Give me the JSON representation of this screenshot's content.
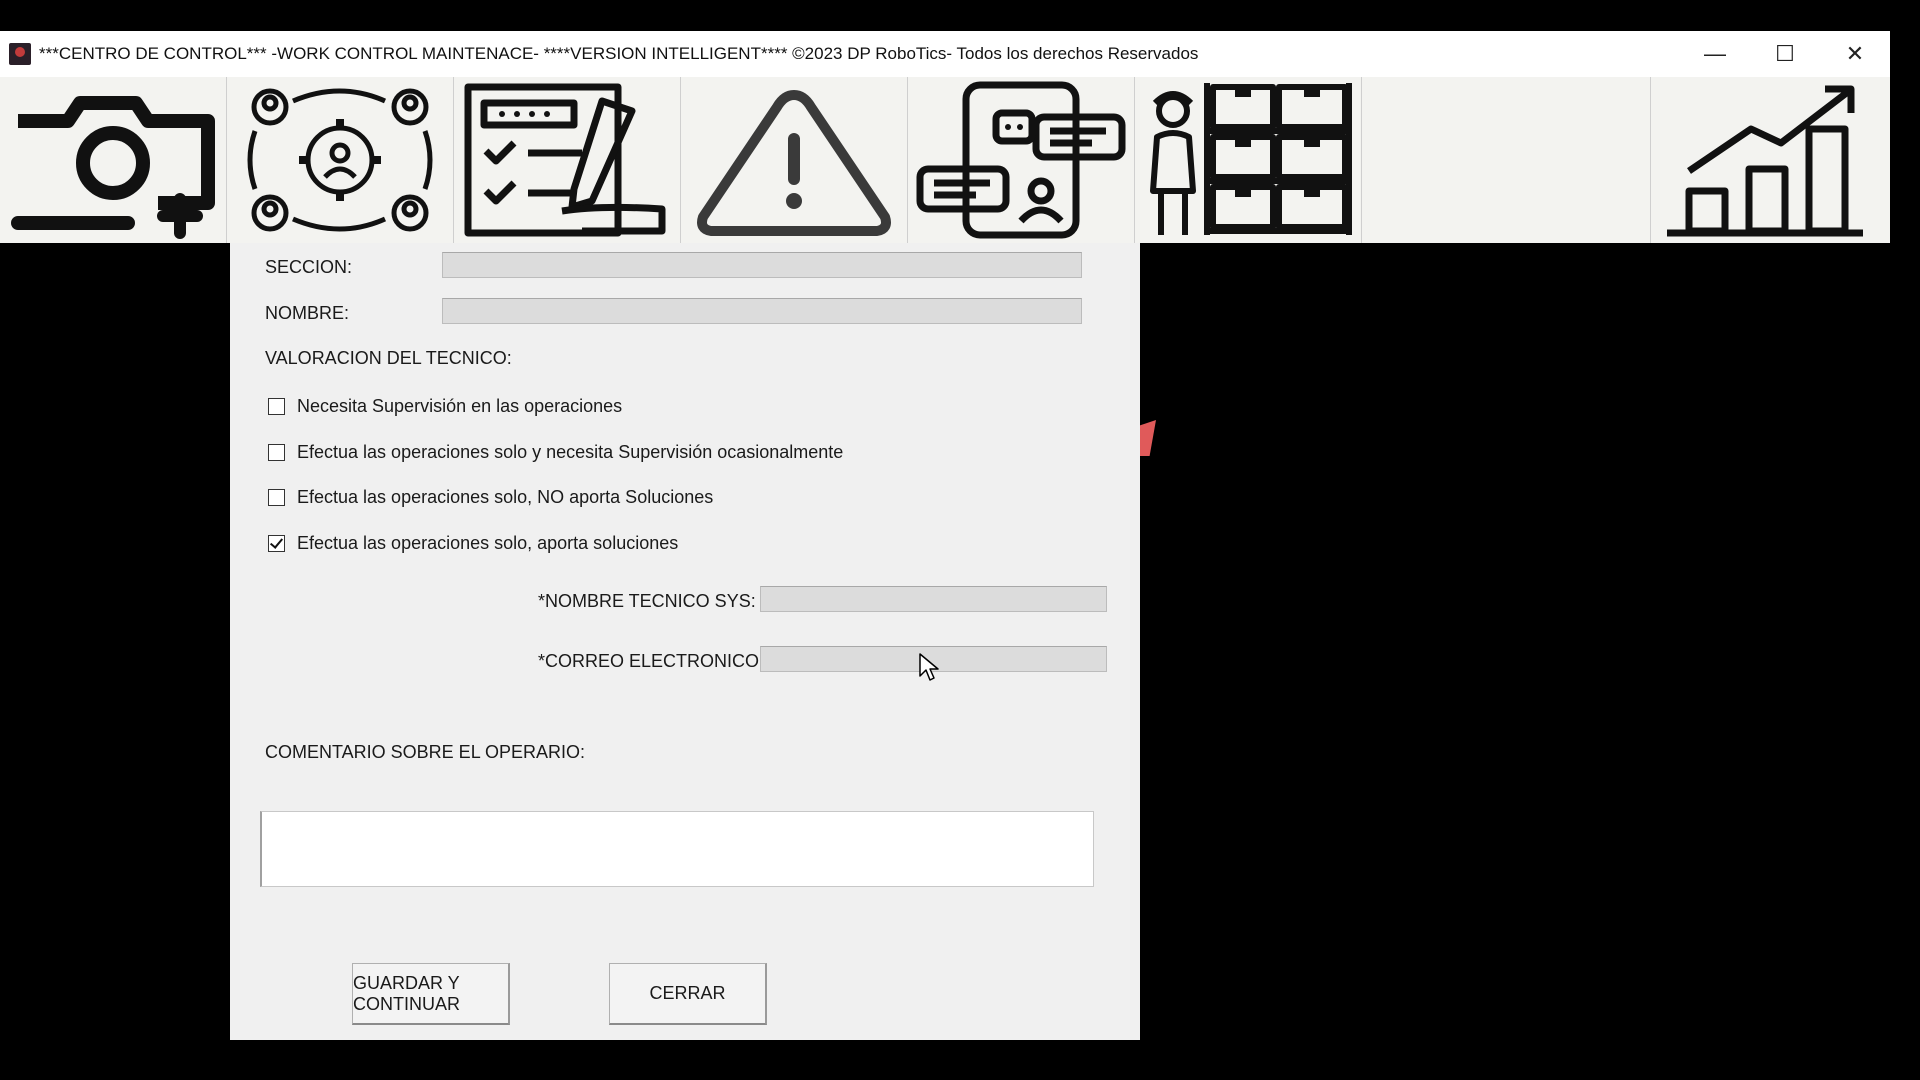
{
  "window": {
    "title": "***CENTRO DE CONTROL*** -WORK CONTROL MAINTENACE- ****VERSION INTELLIGENT****  ©2023 DP RoboTics- Todos los derechos Reservados",
    "controls": {
      "minimize": "—",
      "maximize": "☐",
      "close": "✕"
    }
  },
  "toolbar": {
    "buttons": [
      {
        "icon": "camera-plus-icon"
      },
      {
        "icon": "team-gear-cycle-icon"
      },
      {
        "icon": "checklist-sign-icon"
      },
      {
        "icon": "warning-triangle-icon"
      },
      {
        "icon": "phone-chat-icon"
      },
      {
        "icon": "warehouse-worker-icon"
      },
      {
        "icon": "growth-chart-icon"
      }
    ]
  },
  "form": {
    "seccion_label": "SECCION:",
    "nombre_label": "NOMBRE:",
    "valoracion_label": "VALORACION DEL TECNICO:",
    "options": [
      {
        "label": "Necesita Supervisión en las operaciones",
        "checked": false
      },
      {
        "label": "Efectua las operaciones solo y necesita Supervisión ocasionalmente",
        "checked": false
      },
      {
        "label": "Efectua las operaciones solo, NO aporta Soluciones",
        "checked": false
      },
      {
        "label": "Efectua las operaciones solo, aporta soluciones",
        "checked": true
      }
    ],
    "tecnico_label": "*NOMBRE TECNICO SYS:",
    "correo_label": "*CORREO ELECTRONICO:",
    "comentario_label": "COMENTARIO SOBRE EL OPERARIO:",
    "seccion_value": "",
    "nombre_value": "",
    "tecnico_value": "",
    "correo_value": "",
    "comentario_value": ""
  },
  "buttons": {
    "save": "GUARDAR Y CONTINUAR",
    "close": "CERRAR"
  },
  "colors": {
    "background": "#000000",
    "window": "#f0f0f0",
    "field": "#dcdcdc"
  }
}
